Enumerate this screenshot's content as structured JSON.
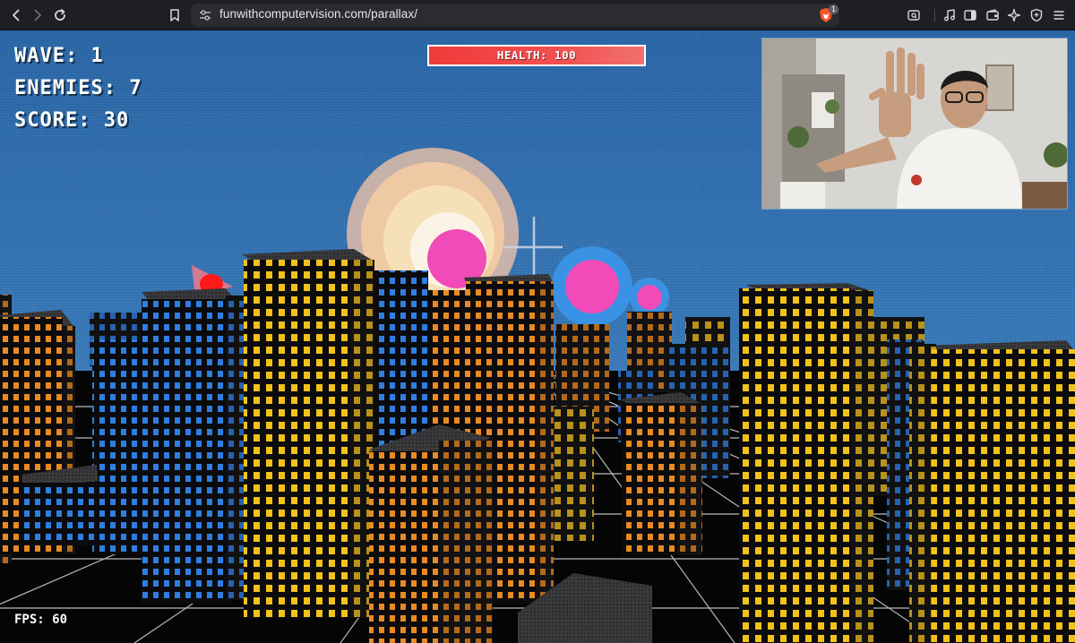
{
  "browser": {
    "url": "funwithcomputervision.com/parallax/",
    "shield_badge": "1",
    "icons": {
      "back": "chevron-left-icon",
      "forward": "chevron-right-icon",
      "reload": "reload-icon",
      "bookmark": "bookmark-icon",
      "site_info": "site-settings-icon",
      "brave_shields": "brave-lion-icon",
      "reader": "reader-mode-icon",
      "media": "music-note-icon",
      "sidebar": "sidebar-icon",
      "wallet": "wallet-icon",
      "leo": "sparkle-icon",
      "vpn": "vpn-shield-icon",
      "menu": "hamburger-menu-icon"
    }
  },
  "hud": {
    "wave": "WAVE: 1",
    "enemies": "ENEMIES: 7",
    "score": "SCORE: 30",
    "fps": "FPS: 60",
    "health_label": "HEALTH: 100",
    "health_fraction": 1.0
  },
  "colors": {
    "sky_top": "#2a6aa8",
    "sky_bottom": "#5c8cc4",
    "window_yellow": "#f2c21b",
    "window_orange": "#e98a22",
    "window_blue": "#2f7fe0",
    "enemy_pink": "#f04bb8",
    "enemy_blue_ring": "#3a92e4",
    "health_red": "#f03a3a"
  }
}
